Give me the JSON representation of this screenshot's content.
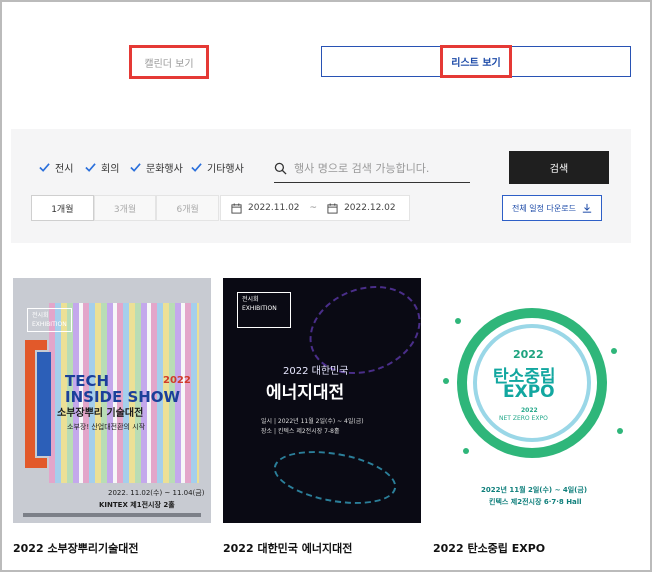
{
  "view_toggle": {
    "calendar": "캘린더 보기",
    "list": "리스트 보기"
  },
  "filter": {
    "categories": [
      "전시",
      "회의",
      "문화행사",
      "기타행사"
    ],
    "search_placeholder": "행사 명으로 검색 가능합니다.",
    "search_button": "검색",
    "periods": [
      "1개월",
      "3개월",
      "6개월"
    ],
    "active_period": "1개월",
    "date_start": "2022.11.02",
    "date_separator": "~",
    "date_end": "2022.12.02",
    "download_button": "전체 일정 다운로드"
  },
  "cards": [
    {
      "title": "2022 소부장뿌리기술대전",
      "poster": {
        "badge": "전시회\nEXHIBITION",
        "tech_line1": "TECH",
        "tech_line2": "INSIDE SHOW",
        "year": "2022",
        "name": "소부장뿌리 기술대전",
        "sub": "소부장! 산업대전환의 시작",
        "date": "2022. 11.02(수) ~ 11.04(금)",
        "venue": "KINTEX 제1전시장 2홀"
      }
    },
    {
      "title": "2022 대한민국 에너지대전",
      "poster": {
        "badge": "전시회\nEXHIBITION",
        "year": "2022 대한민국",
        "name": "에너지대전",
        "info1": "일시 | 2022년 11월 2일(수) ~ 4일(금)",
        "info2": "장소 | 킨텍스 제2전시장 7-8홀"
      }
    },
    {
      "title": "2022 탄소중립 EXPO",
      "poster": {
        "year": "2022",
        "name1": "탄소중립",
        "name2": "EXPO",
        "year2": "2022",
        "sub": "NET ZERO EXPO",
        "date": "2022년 11월 2일(수) ~ 4일(금)",
        "venue": "킨텍스 제2전시장 6·7·8 Hall"
      }
    }
  ],
  "colors": {
    "accent": "#1d4ba8",
    "highlight": "#e53935",
    "check": "#2a6fdb",
    "dark_button": "#1f1f1f"
  }
}
